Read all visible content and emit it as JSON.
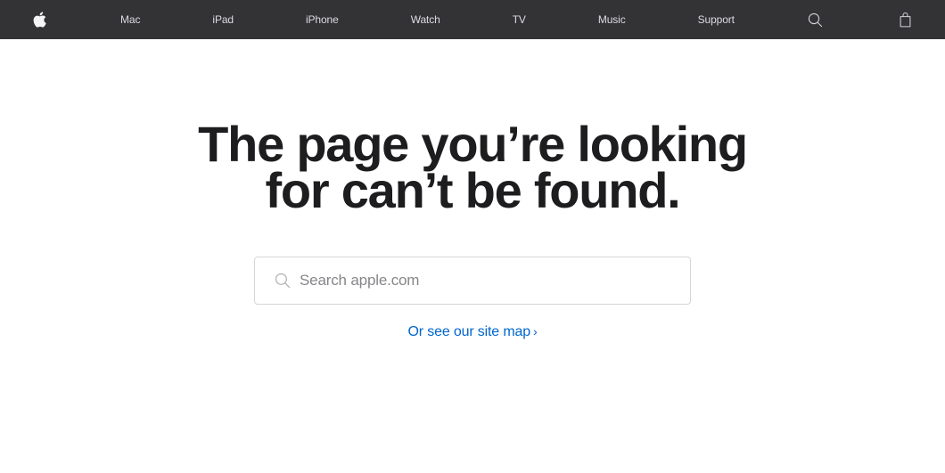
{
  "globalnav": {
    "background_color": "#333336",
    "text_color": "#e8e8ed",
    "apple_logo_label": "Apple",
    "items": [
      {
        "label": "Mac"
      },
      {
        "label": "iPad"
      },
      {
        "label": "iPhone"
      },
      {
        "label": "Watch"
      },
      {
        "label": "TV"
      },
      {
        "label": "Music"
      },
      {
        "label": "Support"
      }
    ],
    "search_icon_label": "Search",
    "bag_icon_label": "Shopping Bag"
  },
  "main": {
    "headline_line1": "The page you’re looking",
    "headline_line2": "for can’t be found.",
    "headline_color": "#1d1d1f"
  },
  "search": {
    "value": "",
    "placeholder": "Search apple.com",
    "icon": "search-icon",
    "border_color": "#d6d6d6",
    "placeholder_color": "#86868b"
  },
  "sitemap": {
    "label": "Or see our site map",
    "chevron": "›",
    "link_color": "#0066cc"
  }
}
